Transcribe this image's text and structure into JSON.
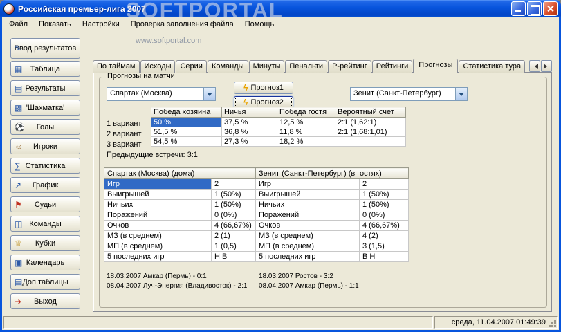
{
  "titlebar": {
    "title": "Российская премьер-лига 2007"
  },
  "watermark": {
    "title": "SOFTPORTAL",
    "url": "www.softportal.com"
  },
  "menu": {
    "items": [
      "Файл",
      "Показать",
      "Настройки",
      "Проверка заполнения файла",
      "Помощь"
    ]
  },
  "sidebar": {
    "items": [
      {
        "label": "Ввод результатов",
        "icon": "edit-icon",
        "glyph": "✎"
      },
      {
        "label": "Таблица",
        "icon": "table-icon",
        "glyph": "▦"
      },
      {
        "label": "Результаты",
        "icon": "results-icon",
        "glyph": "▤"
      },
      {
        "label": "'Шахматка'",
        "icon": "crosstable-icon",
        "glyph": "▩"
      },
      {
        "label": "Голы",
        "icon": "ball-icon",
        "glyph": "⚽"
      },
      {
        "label": "Игроки",
        "icon": "players-icon",
        "glyph": "☺"
      },
      {
        "label": "Статистика",
        "icon": "statistics-icon",
        "glyph": "∑"
      },
      {
        "label": "График",
        "icon": "chart-icon",
        "glyph": "↗"
      },
      {
        "label": "Судьи",
        "icon": "referee-flag-icon",
        "glyph": "⚑"
      },
      {
        "label": "Команды",
        "icon": "teams-icon",
        "glyph": "◫"
      },
      {
        "label": "Кубки",
        "icon": "cup-icon",
        "glyph": "♕"
      },
      {
        "label": "Календарь",
        "icon": "calendar-icon",
        "glyph": "▣"
      },
      {
        "label": "Доп.таблицы",
        "icon": "extra-tables-icon",
        "glyph": "▤"
      },
      {
        "label": "Выход",
        "icon": "exit-icon",
        "glyph": "➜"
      }
    ]
  },
  "tabs": {
    "items": [
      "По таймам",
      "Исходы",
      "Серии",
      "Команды",
      "Минуты",
      "Пенальти",
      "Р-рейтинг",
      "Рейтинги",
      "Прогнозы",
      "Статистика тура"
    ],
    "active": "Прогнозы"
  },
  "forecast": {
    "group_title": "Прогнозы на матчи",
    "home_team": "Спартак (Москва)",
    "away_team": "Зенит (Санкт-Петербург)",
    "buttons": {
      "b1": "Прогноз1",
      "b2": "Прогноз2",
      "bolt": "ϟ"
    },
    "table": {
      "row_labels": [
        "1 вариант",
        "2 вариант",
        "3 вариант"
      ],
      "headers": [
        "Победа хозяина",
        "Ничья",
        "Победа гостя",
        "Вероятный счет"
      ],
      "rows": [
        [
          "50 %",
          "37,5 %",
          "12,5 %",
          "2:1 (1,62:1)"
        ],
        [
          "51,5 %",
          "36,8 %",
          "11,8 %",
          "2:1 (1,68:1,01)"
        ],
        [
          "54,5 %",
          "27,3 %",
          "18,2 %",
          ""
        ]
      ]
    },
    "previous": "Предыдущие встречи: 3:1",
    "stats": {
      "home_header": "Спартак (Москва) (дома)",
      "away_header": "Зенит (Санкт-Петербург) (в гостях)",
      "rows": [
        [
          "Игр",
          "2",
          "Игр",
          "2"
        ],
        [
          "Выигрышей",
          "1 (50%)",
          "Выигрышей",
          "1 (50%)"
        ],
        [
          "Ничьих",
          "1 (50%)",
          "Ничьих",
          "1 (50%)"
        ],
        [
          "Поражений",
          "0 (0%)",
          "Поражений",
          "0 (0%)"
        ],
        [
          "Очков",
          "4 (66,67%)",
          "Очков",
          "4 (66,67%)"
        ],
        [
          "МЗ (в среднем)",
          "2 (1)",
          "МЗ (в среднем)",
          "4 (2)"
        ],
        [
          "МП (в среднем)",
          "1 (0,5)",
          "МП (в среднем)",
          "3 (1,5)"
        ],
        [
          "5 последних игр",
          "Н В",
          "5 последних игр",
          "В Н"
        ]
      ]
    },
    "history": {
      "home": [
        "18.03.2007 Амкар (Пермь) - 0:1",
        "08.04.2007 Луч-Энергия (Владивосток) - 2:1"
      ],
      "away": [
        "18.03.2007 Ростов - 3:2",
        "08.04.2007 Амкар (Пермь) - 1:1"
      ]
    }
  },
  "statusbar": {
    "datetime": "среда, 11.04.2007 01:49:39"
  },
  "colors": {
    "titlebar": "#0855DD",
    "selection": "#316AC5",
    "window_bg": "#ECE9D8"
  }
}
